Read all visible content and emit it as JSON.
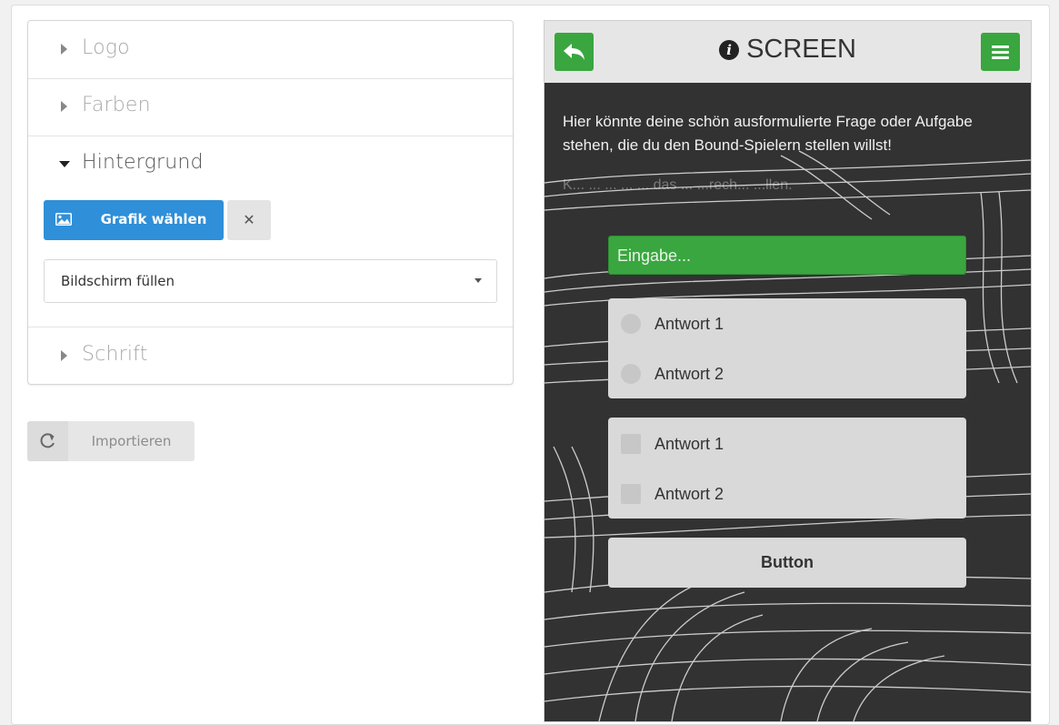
{
  "accordion": {
    "sections": [
      {
        "label": "Logo",
        "open": false
      },
      {
        "label": "Farben",
        "open": false
      },
      {
        "label": "Hintergrund",
        "open": true
      },
      {
        "label": "Schrift",
        "open": false
      }
    ],
    "background": {
      "choose_button": "Grafik wählen",
      "clear_icon": "close-icon",
      "mode_select": {
        "value": "Bildschirm füllen"
      }
    }
  },
  "import_button": {
    "label": "Importieren",
    "icon": "refresh-icon"
  },
  "preview": {
    "title": "SCREEN",
    "title_icon": "info-icon",
    "back_icon": "reply-icon",
    "menu_icon": "hamburger-icon",
    "question": "Hier könnte deine schön ausformulierte Frage oder Aufgabe stehen, die du den Bound-Spielern stellen willst!",
    "hint": "K... ... ... ... ... das ... ...rech... ...llen.",
    "input_placeholder": "Eingabe...",
    "radio_options": [
      "Antwort 1",
      "Antwort 2"
    ],
    "checkbox_options": [
      "Antwort 1",
      "Antwort 2"
    ],
    "button_label": "Button"
  },
  "colors": {
    "primary_blue": "#2f8fd8",
    "green": "#3aa63f",
    "panel_gray": "#d9d9d9"
  }
}
